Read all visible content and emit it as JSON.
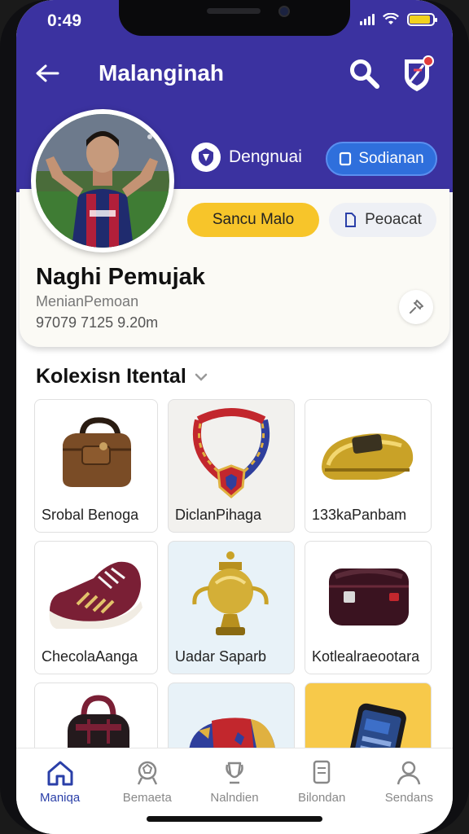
{
  "status_bar": {
    "time": "0:49"
  },
  "header": {
    "title": "Malanginah"
  },
  "team": {
    "name": "Dengnuai"
  },
  "actions": {
    "primary": "Sodianan",
    "follow": "Sancu Malo",
    "secondary": "Peoacat"
  },
  "profile": {
    "name": "Naghi Pemujak",
    "subtitle": "MenianPemoan",
    "stats": "97079 7125 9.20m"
  },
  "collection": {
    "title": "Kolexisn Itental",
    "items": [
      {
        "label": "Srobal Benoga",
        "icon": "bag-icon"
      },
      {
        "label": "DiclanPihaga",
        "icon": "necklace-icon"
      },
      {
        "label": "133kaPanbam",
        "icon": "golden-shoe-icon"
      },
      {
        "label": "ChecolaAanga",
        "icon": "sneaker-icon"
      },
      {
        "label": "Uadar Saparb",
        "icon": "trophy-icon"
      },
      {
        "label": "Kotlealraeootara",
        "icon": "pouch-icon"
      },
      {
        "label": "",
        "icon": "backpack-icon"
      },
      {
        "label": "",
        "icon": "cap-icon"
      },
      {
        "label": "",
        "icon": "phone-icon"
      }
    ]
  },
  "nav": [
    {
      "label": "Maniqa",
      "icon": "home-icon",
      "active": true
    },
    {
      "label": "Bemaeta",
      "icon": "ball-icon",
      "active": false
    },
    {
      "label": "Nalndien",
      "icon": "trophy-outline-icon",
      "active": false
    },
    {
      "label": "Bilondan",
      "icon": "document-icon",
      "active": false
    },
    {
      "label": "Sendans",
      "icon": "profile-icon",
      "active": false
    }
  ],
  "colors": {
    "header": "#3b32a0",
    "primary_button": "#2f6fdc",
    "follow_button": "#f7c52a",
    "nav_active": "#2a3fa8"
  }
}
